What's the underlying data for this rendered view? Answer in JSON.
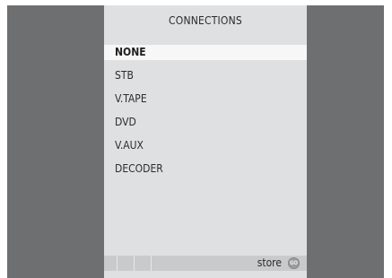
{
  "menu": {
    "title": "CONNECTIONS",
    "items": [
      {
        "label": "NONE",
        "selected": true
      },
      {
        "label": "STB",
        "selected": false
      },
      {
        "label": "V.TAPE",
        "selected": false
      },
      {
        "label": "DVD",
        "selected": false
      },
      {
        "label": "V.AUX",
        "selected": false
      },
      {
        "label": "DECODER",
        "selected": false
      }
    ]
  },
  "footer": {
    "store_label": "store",
    "go_icon": "go-button-icon",
    "go_text": "GO"
  },
  "colors": {
    "frame": "#6e6f71",
    "menu_background": "#dfe0e1",
    "selected_background": "#f7f7f7",
    "footer_bar": "#c9cacb"
  }
}
